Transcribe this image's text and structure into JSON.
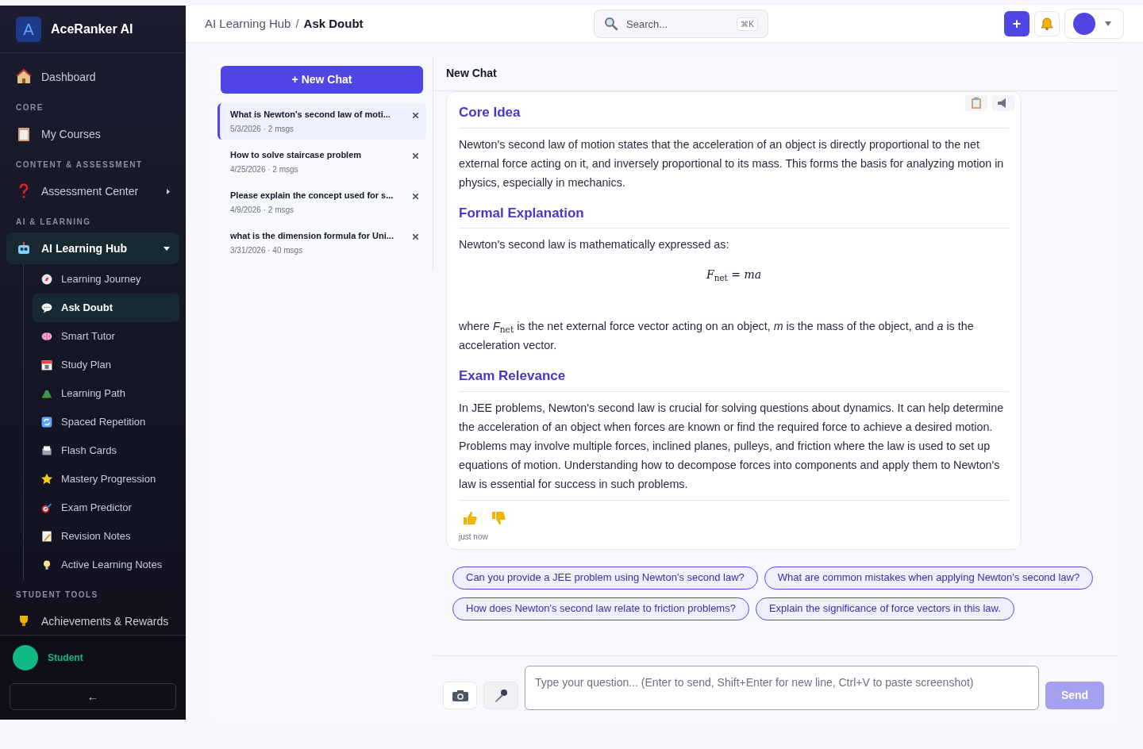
{
  "brand": {
    "name": "AceRanker AI",
    "logo": "A"
  },
  "sidebar": {
    "items": [
      {
        "kind": "link",
        "label": "Dashboard",
        "selected": false
      },
      {
        "kind": "heading",
        "label": "CORE"
      },
      {
        "kind": "link",
        "label": "My Courses",
        "selected": false
      },
      {
        "kind": "heading",
        "label": "CONTENT & ASSESSMENT"
      },
      {
        "kind": "link",
        "label": "Assessment Center",
        "selected": false,
        "expanded": false
      },
      {
        "kind": "heading",
        "label": "AI & LEARNING"
      },
      {
        "kind": "group",
        "label": "AI Learning Hub",
        "selected": true,
        "expanded": true,
        "children": [
          {
            "label": "Learning Journey",
            "selected": false
          },
          {
            "label": "Ask Doubt",
            "selected": true
          },
          {
            "label": "Smart Tutor",
            "selected": false
          },
          {
            "label": "Study Plan",
            "selected": false
          },
          {
            "label": "Learning Path",
            "selected": false
          },
          {
            "label": "Spaced Repetition",
            "selected": false
          },
          {
            "label": "Flash Cards",
            "selected": false
          },
          {
            "label": "Mastery Progression",
            "selected": false
          },
          {
            "label": "Exam Predictor",
            "selected": false
          },
          {
            "label": "Revision Notes",
            "selected": false
          },
          {
            "label": "Active Learning Notes",
            "selected": false
          }
        ]
      },
      {
        "kind": "heading",
        "label": "STUDENT TOOLS"
      },
      {
        "kind": "link",
        "label": "Achievements & Rewards",
        "selected": false
      }
    ]
  },
  "user": {
    "name": "Student"
  },
  "collapse_button": {
    "label": "←"
  },
  "header": {
    "breadcrumb": [
      "AI Learning Hub",
      "Ask Doubt"
    ],
    "separator": "/",
    "search": {
      "placeholder": "Search...",
      "shortcut": "⌘K"
    },
    "add_button": "+"
  },
  "chat_list": {
    "new_chat_button": "+ New Chat",
    "items": [
      {
        "title": "What is Newton's second law of moti...",
        "meta": "5/3/2026 · 2 msgs",
        "selected": true
      },
      {
        "title": "How to solve staircase problem",
        "meta": "4/25/2026 · 2 msgs",
        "selected": false
      },
      {
        "title": "Please explain the concept used for s...",
        "meta": "4/9/2026 · 2 msgs",
        "selected": false
      },
      {
        "title": "what is the dimension formula for Uni...",
        "meta": "3/31/2026 · 40 msgs",
        "selected": false
      }
    ]
  },
  "chat": {
    "title": "New Chat",
    "message": {
      "blocks": [
        {
          "kind": "heading",
          "text": "Core Idea"
        },
        {
          "kind": "paragraph",
          "text": "Newton's second law of motion states that the acceleration of an object is directly proportional to the net external force acting on it, and inversely proportional to its mass. This forms the basis for analyzing motion in physics, especially in mechanics."
        },
        {
          "kind": "heading",
          "text": "Formal Explanation"
        },
        {
          "kind": "paragraph",
          "text": "Newton's second law is mathematically expressed as:"
        },
        {
          "kind": "equation",
          "text": "*F*$_{net}$ = *ma*"
        },
        {
          "kind": "paragraph",
          "text": "where *F*$_{net}$ is the net external force vector acting on an object, *m* is the mass of the object, and *a* is the acceleration vector."
        },
        {
          "kind": "heading",
          "text": "Exam Relevance"
        },
        {
          "kind": "paragraph",
          "text": "In JEE problems, Newton's second law is crucial for solving questions about dynamics. It can help determine the acceleration of an object when forces are known or find the required force to achieve a desired motion. Problems may involve multiple forces, inclined planes, pulleys, and friction where the law is used to set up equations of motion. Understanding how to decompose forces into components and apply them to Newton's law is essential for success in such problems."
        }
      ],
      "time": "just now"
    },
    "suggestions": [
      "Can you provide a JEE problem using Newton's second law?",
      "What are common mistakes when applying Newton's second law?",
      "How does Newton's second law relate to friction problems?",
      "Explain the significance of force vectors in this law."
    ],
    "input": {
      "placeholder": "Type your question... (Enter to send, Shift+Enter for new line, Ctrl+V to paste screenshot)"
    },
    "send_button": {
      "label": "Send",
      "disabled": true
    }
  }
}
